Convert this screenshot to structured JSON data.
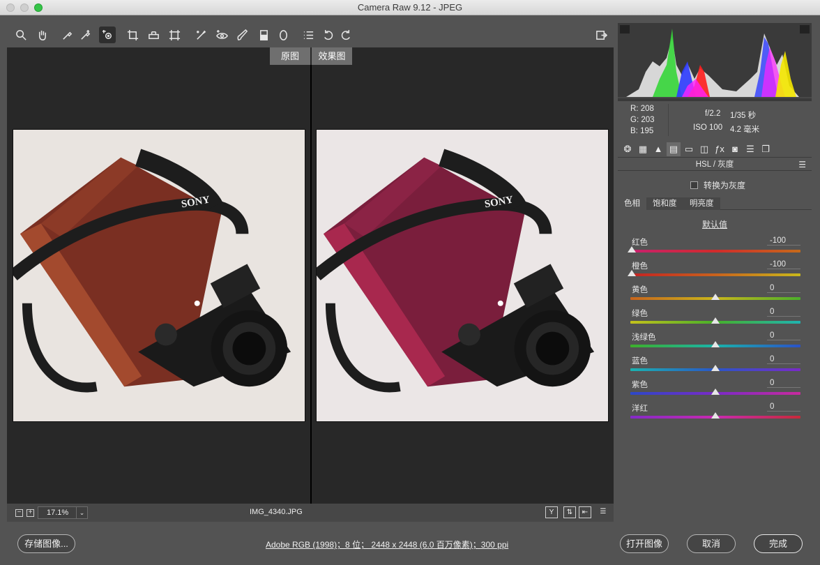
{
  "window": {
    "title": "Camera Raw 9.12 -  JPEG"
  },
  "toolbar": {
    "tools": [
      "zoom-icon",
      "hand-icon",
      "white-balance-icon",
      "color-sampler-icon",
      "targeted-adjustment-icon",
      "crop-icon",
      "straighten-icon",
      "transform-icon",
      "spot-removal-icon",
      "red-eye-icon",
      "adjustment-brush-icon",
      "graduated-filter-icon",
      "radial-filter-icon",
      "list-icon",
      "rotate-left-icon",
      "rotate-right-icon"
    ],
    "fullscreen_icon": "fullscreen-icon"
  },
  "preview": {
    "before_label": "原图",
    "after_label": "效果图",
    "camera_brand": "SONY"
  },
  "bottombar": {
    "zoom_value": "17.1%",
    "zoom_out": "−",
    "zoom_in": "+",
    "filename": "IMG_4340.JPG"
  },
  "readout": {
    "r_label": "R:",
    "r_value": "208",
    "g_label": "G:",
    "g_value": "203",
    "b_label": "B:",
    "b_value": "195",
    "aperture": "f/2.2",
    "shutter": "1/35 秒",
    "iso": "ISO 100",
    "focal": "4.2 毫米"
  },
  "panel": {
    "title": "HSL / 灰度",
    "convert_gray": "转换为灰度",
    "tabs": [
      "色相",
      "饱和度",
      "明亮度"
    ],
    "defaults": "默认值",
    "sliders": [
      {
        "label": "红色",
        "value": "-100",
        "level": -100
      },
      {
        "label": "橙色",
        "value": "-100",
        "level": -100
      },
      {
        "label": "黄色",
        "value": "0",
        "level": 0
      },
      {
        "label": "绿色",
        "value": "0",
        "level": 0
      },
      {
        "label": "浅绿色",
        "value": "0",
        "level": 0
      },
      {
        "label": "蓝色",
        "value": "0",
        "level": 0
      },
      {
        "label": "紫色",
        "value": "0",
        "level": 0
      },
      {
        "label": "洋红",
        "value": "0",
        "level": 0
      }
    ]
  },
  "footer": {
    "save_label": "存储图像...",
    "info": "Adobe RGB (1998)；8 位；  2448 x 2448 (6.0 百万像素)；300 ppi",
    "open_label": "打开图像",
    "cancel_label": "取消",
    "done_label": "完成"
  }
}
